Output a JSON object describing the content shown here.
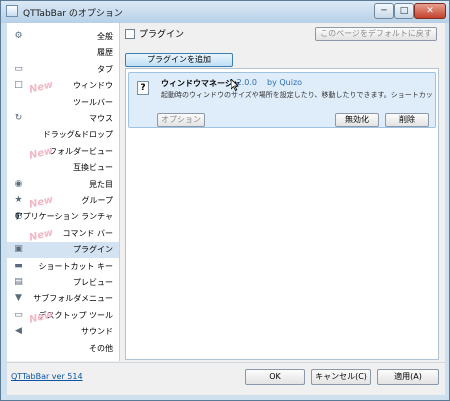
{
  "window": {
    "title": "QTTabBar のオプション",
    "min_glyph": "─",
    "max_glyph": "□",
    "close_glyph": "✕"
  },
  "sidebar": {
    "new_badge": "New",
    "items": [
      {
        "label": "全般",
        "icon": "gear-icon",
        "glyph": "⚙"
      },
      {
        "label": "履歴",
        "icon": "",
        "glyph": ""
      },
      {
        "label": "タブ",
        "icon": "tab-icon",
        "glyph": "▭"
      },
      {
        "label": "ウィンドウ",
        "icon": "window-icon",
        "glyph": "□"
      },
      {
        "label": "ツールバー",
        "icon": "",
        "glyph": ""
      },
      {
        "label": "マウス",
        "icon": "mouse-icon",
        "glyph": "↻"
      },
      {
        "label": "ドラッグ&ドロップ",
        "icon": "",
        "glyph": ""
      },
      {
        "label": "フォルダービュー",
        "icon": "",
        "glyph": ""
      },
      {
        "label": "互換ビュー",
        "icon": "",
        "glyph": ""
      },
      {
        "label": "見た目",
        "icon": "eye-icon",
        "glyph": "◉"
      },
      {
        "label": "グループ",
        "icon": "star-icon",
        "glyph": "★"
      },
      {
        "label": "アプリケーション ランチャ",
        "icon": "launcher-icon",
        "glyph": "◐"
      },
      {
        "label": "コマンド バー",
        "icon": "",
        "glyph": ""
      },
      {
        "label": "プラグイン",
        "icon": "plugin-icon",
        "glyph": "▣"
      },
      {
        "label": "ショートカット キー",
        "icon": "keyboard-icon",
        "glyph": "▬"
      },
      {
        "label": "プレビュー",
        "icon": "preview-icon",
        "glyph": "▤"
      },
      {
        "label": "サブフォルダメニュー",
        "icon": "subfolder-icon",
        "glyph": "▼"
      },
      {
        "label": "デスクトップ ツール",
        "icon": "desktop-icon",
        "glyph": "▭"
      },
      {
        "label": "サウンド",
        "icon": "sound-icon",
        "glyph": "◀"
      },
      {
        "label": "その他",
        "icon": "",
        "glyph": ""
      }
    ],
    "selected_index": 13
  },
  "panel": {
    "title": "プラグイン",
    "default_button": "このページをデフォルトに戻す",
    "add_button": "プラグインを追加"
  },
  "plugin": {
    "name": "ウィンドウマネージャ",
    "version": "1.2.0.0",
    "author": "by Quizo",
    "description": "起動時のウィンドウのサイズや場所を設定したり、移動したりできます。ショートカットも提供しま",
    "options_button": "オプション",
    "disable_button": "無効化",
    "delete_button": "削除",
    "help_glyph": "?"
  },
  "footer": {
    "version": "QTTabBar ver 514",
    "ok": "OK",
    "cancel": "キャンセル(C)",
    "apply": "適用(A)"
  }
}
